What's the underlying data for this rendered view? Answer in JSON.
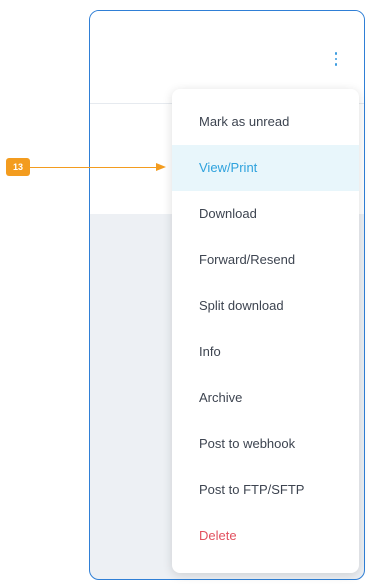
{
  "annotation": {
    "step_number": "13",
    "color": "#f39c1f"
  },
  "panel": {
    "border_color": "#2f7fd6",
    "more_icon": "more-vertical-icon"
  },
  "menu": {
    "items": [
      {
        "label": "Mark as unread",
        "state": "normal"
      },
      {
        "label": "View/Print",
        "state": "highlighted"
      },
      {
        "label": "Download",
        "state": "normal"
      },
      {
        "label": "Forward/Resend",
        "state": "normal"
      },
      {
        "label": "Split download",
        "state": "normal"
      },
      {
        "label": "Info",
        "state": "normal"
      },
      {
        "label": "Archive",
        "state": "normal"
      },
      {
        "label": "Post to webhook",
        "state": "normal"
      },
      {
        "label": "Post to FTP/SFTP",
        "state": "normal"
      },
      {
        "label": "Delete",
        "state": "danger"
      }
    ],
    "highlight_color": "#2ea2dd",
    "danger_color": "#e2515f"
  }
}
